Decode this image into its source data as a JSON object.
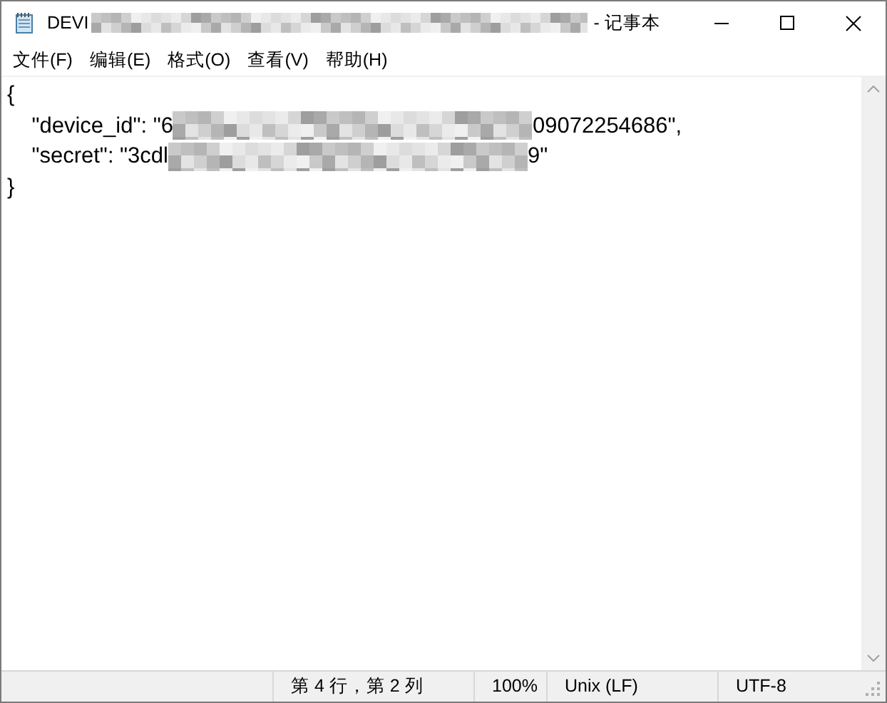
{
  "window": {
    "title": [
      {
        "kind": "text",
        "text": "DEVI"
      },
      {
        "kind": "pixelated"
      },
      {
        "kind": "text",
        "text": "- 记事本"
      }
    ]
  },
  "menu": [
    "文件(F)",
    "编辑(E)",
    "格式(O)",
    "查看(V)",
    "帮助(H)"
  ],
  "editor": {
    "lines": [
      [
        {
          "kind": "text",
          "text": "{"
        }
      ],
      [
        {
          "kind": "text",
          "text": "    \"device_id\": \"6"
        },
        {
          "kind": "pixelated"
        },
        {
          "kind": "text",
          "text": "09072254686\","
        }
      ],
      [
        {
          "kind": "text",
          "text": "    \"secret\": \"3cdl"
        },
        {
          "kind": "pixelated"
        },
        {
          "kind": "text",
          "text": "9\""
        }
      ],
      [
        {
          "kind": "text",
          "text": "}"
        }
      ]
    ]
  },
  "status_bar": {
    "position": "第 4 行，第 2 列",
    "zoom": "100%",
    "line_ending": "Unix (LF)",
    "encoding": "UTF-8"
  }
}
